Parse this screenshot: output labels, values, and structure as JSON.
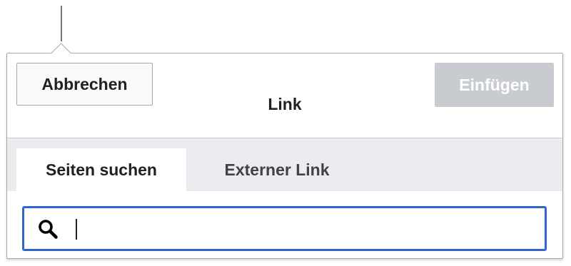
{
  "dialog": {
    "title": "Link",
    "cancel_label": "Abbrechen",
    "insert_label": "Einfügen",
    "insert_enabled": false
  },
  "tabs": [
    {
      "label": "Seiten suchen",
      "active": true
    },
    {
      "label": "Externer Link",
      "active": false
    }
  ],
  "search": {
    "value": "",
    "placeholder": "",
    "icon": "search-icon"
  },
  "colors": {
    "accent": "#3366cc",
    "disabled_button": "#c8ccd1",
    "tabbar_bg": "#eaecf0",
    "border": "#a2a9b1"
  }
}
